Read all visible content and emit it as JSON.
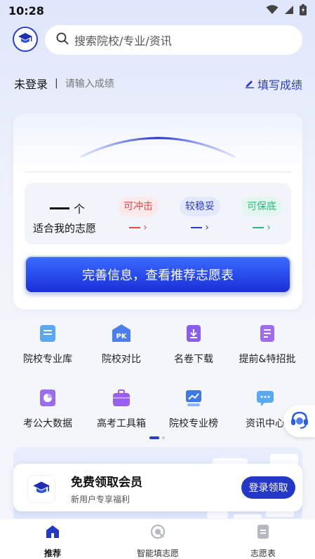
{
  "status_bar": {
    "time": "10:28"
  },
  "search": {
    "placeholder": "搜索院校/专业/资讯"
  },
  "login_row": {
    "status": "未登录",
    "separator": "|",
    "hint": "请输入成绩",
    "fill_score": "填写成绩"
  },
  "recommend_card": {
    "count_unit": "个",
    "count_desc": "适合我的志愿",
    "categories": [
      {
        "label": "可冲击",
        "color": "#e0484a",
        "bg": "#fde8ea"
      },
      {
        "label": "较稳妥",
        "color": "#2a3cc9",
        "bg": "#e4e8fb"
      },
      {
        "label": "可保底",
        "color": "#2bb784",
        "bg": "#e3f6ee"
      }
    ],
    "cta": "完善信息，查看推荐志愿表"
  },
  "features": [
    {
      "label": "院校专业库",
      "icon": "database-icon"
    },
    {
      "label": "院校对比",
      "icon": "pk-compare-icon"
    },
    {
      "label": "名卷下载",
      "icon": "download-icon"
    },
    {
      "label": "提前&特招批",
      "icon": "document-list-icon"
    },
    {
      "label": "考公大数据",
      "icon": "pie-chart-icon"
    },
    {
      "label": "高考工具箱",
      "icon": "toolbox-icon"
    },
    {
      "label": "院校专业榜",
      "icon": "ranking-chart-icon"
    },
    {
      "label": "资讯中心",
      "icon": "chat-bubble-icon"
    }
  ],
  "pager": {
    "pages": 2,
    "current": 1
  },
  "member": {
    "title": "免费领取会员",
    "subtitle": "新用户专享福利",
    "button": "登录领取"
  },
  "bottom_nav": [
    {
      "label": "推荐",
      "icon": "home-icon",
      "active": true
    },
    {
      "label": "智能填志愿",
      "icon": "smart-fill-icon",
      "active": false
    },
    {
      "label": "志愿表",
      "icon": "list-doc-icon",
      "active": false
    }
  ],
  "colors": {
    "primary": "#2a3cc9",
    "cta": "#1a2fd8"
  }
}
